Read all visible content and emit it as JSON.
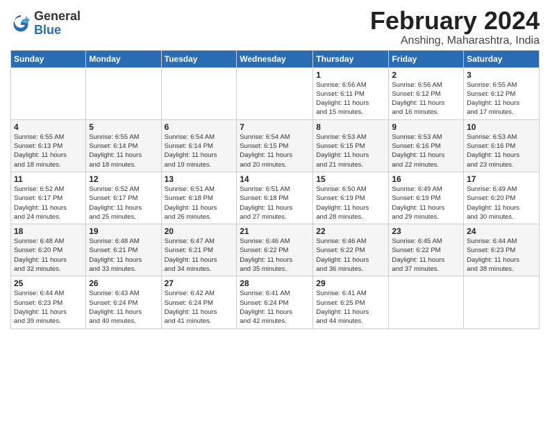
{
  "header": {
    "logo_general": "General",
    "logo_blue": "Blue",
    "main_title": "February 2024",
    "subtitle": "Anshing, Maharashtra, India"
  },
  "calendar": {
    "days_of_week": [
      "Sunday",
      "Monday",
      "Tuesday",
      "Wednesday",
      "Thursday",
      "Friday",
      "Saturday"
    ],
    "weeks": [
      [
        {
          "day": "",
          "info": ""
        },
        {
          "day": "",
          "info": ""
        },
        {
          "day": "",
          "info": ""
        },
        {
          "day": "",
          "info": ""
        },
        {
          "day": "1",
          "info": "Sunrise: 6:56 AM\nSunset: 6:11 PM\nDaylight: 11 hours\nand 15 minutes."
        },
        {
          "day": "2",
          "info": "Sunrise: 6:56 AM\nSunset: 6:12 PM\nDaylight: 11 hours\nand 16 minutes."
        },
        {
          "day": "3",
          "info": "Sunrise: 6:55 AM\nSunset: 6:12 PM\nDaylight: 11 hours\nand 17 minutes."
        }
      ],
      [
        {
          "day": "4",
          "info": "Sunrise: 6:55 AM\nSunset: 6:13 PM\nDaylight: 11 hours\nand 18 minutes."
        },
        {
          "day": "5",
          "info": "Sunrise: 6:55 AM\nSunset: 6:14 PM\nDaylight: 11 hours\nand 18 minutes."
        },
        {
          "day": "6",
          "info": "Sunrise: 6:54 AM\nSunset: 6:14 PM\nDaylight: 11 hours\nand 19 minutes."
        },
        {
          "day": "7",
          "info": "Sunrise: 6:54 AM\nSunset: 6:15 PM\nDaylight: 11 hours\nand 20 minutes."
        },
        {
          "day": "8",
          "info": "Sunrise: 6:53 AM\nSunset: 6:15 PM\nDaylight: 11 hours\nand 21 minutes."
        },
        {
          "day": "9",
          "info": "Sunrise: 6:53 AM\nSunset: 6:16 PM\nDaylight: 11 hours\nand 22 minutes."
        },
        {
          "day": "10",
          "info": "Sunrise: 6:53 AM\nSunset: 6:16 PM\nDaylight: 11 hours\nand 23 minutes."
        }
      ],
      [
        {
          "day": "11",
          "info": "Sunrise: 6:52 AM\nSunset: 6:17 PM\nDaylight: 11 hours\nand 24 minutes."
        },
        {
          "day": "12",
          "info": "Sunrise: 6:52 AM\nSunset: 6:17 PM\nDaylight: 11 hours\nand 25 minutes."
        },
        {
          "day": "13",
          "info": "Sunrise: 6:51 AM\nSunset: 6:18 PM\nDaylight: 11 hours\nand 26 minutes."
        },
        {
          "day": "14",
          "info": "Sunrise: 6:51 AM\nSunset: 6:18 PM\nDaylight: 11 hours\nand 27 minutes."
        },
        {
          "day": "15",
          "info": "Sunrise: 6:50 AM\nSunset: 6:19 PM\nDaylight: 11 hours\nand 28 minutes."
        },
        {
          "day": "16",
          "info": "Sunrise: 6:49 AM\nSunset: 6:19 PM\nDaylight: 11 hours\nand 29 minutes."
        },
        {
          "day": "17",
          "info": "Sunrise: 6:49 AM\nSunset: 6:20 PM\nDaylight: 11 hours\nand 30 minutes."
        }
      ],
      [
        {
          "day": "18",
          "info": "Sunrise: 6:48 AM\nSunset: 6:20 PM\nDaylight: 11 hours\nand 32 minutes."
        },
        {
          "day": "19",
          "info": "Sunrise: 6:48 AM\nSunset: 6:21 PM\nDaylight: 11 hours\nand 33 minutes."
        },
        {
          "day": "20",
          "info": "Sunrise: 6:47 AM\nSunset: 6:21 PM\nDaylight: 11 hours\nand 34 minutes."
        },
        {
          "day": "21",
          "info": "Sunrise: 6:46 AM\nSunset: 6:22 PM\nDaylight: 11 hours\nand 35 minutes."
        },
        {
          "day": "22",
          "info": "Sunrise: 6:46 AM\nSunset: 6:22 PM\nDaylight: 11 hours\nand 36 minutes."
        },
        {
          "day": "23",
          "info": "Sunrise: 6:45 AM\nSunset: 6:22 PM\nDaylight: 11 hours\nand 37 minutes."
        },
        {
          "day": "24",
          "info": "Sunrise: 6:44 AM\nSunset: 6:23 PM\nDaylight: 11 hours\nand 38 minutes."
        }
      ],
      [
        {
          "day": "25",
          "info": "Sunrise: 6:44 AM\nSunset: 6:23 PM\nDaylight: 11 hours\nand 39 minutes."
        },
        {
          "day": "26",
          "info": "Sunrise: 6:43 AM\nSunset: 6:24 PM\nDaylight: 11 hours\nand 40 minutes."
        },
        {
          "day": "27",
          "info": "Sunrise: 6:42 AM\nSunset: 6:24 PM\nDaylight: 11 hours\nand 41 minutes."
        },
        {
          "day": "28",
          "info": "Sunrise: 6:41 AM\nSunset: 6:24 PM\nDaylight: 11 hours\nand 42 minutes."
        },
        {
          "day": "29",
          "info": "Sunrise: 6:41 AM\nSunset: 6:25 PM\nDaylight: 11 hours\nand 44 minutes."
        },
        {
          "day": "",
          "info": ""
        },
        {
          "day": "",
          "info": ""
        }
      ]
    ]
  }
}
